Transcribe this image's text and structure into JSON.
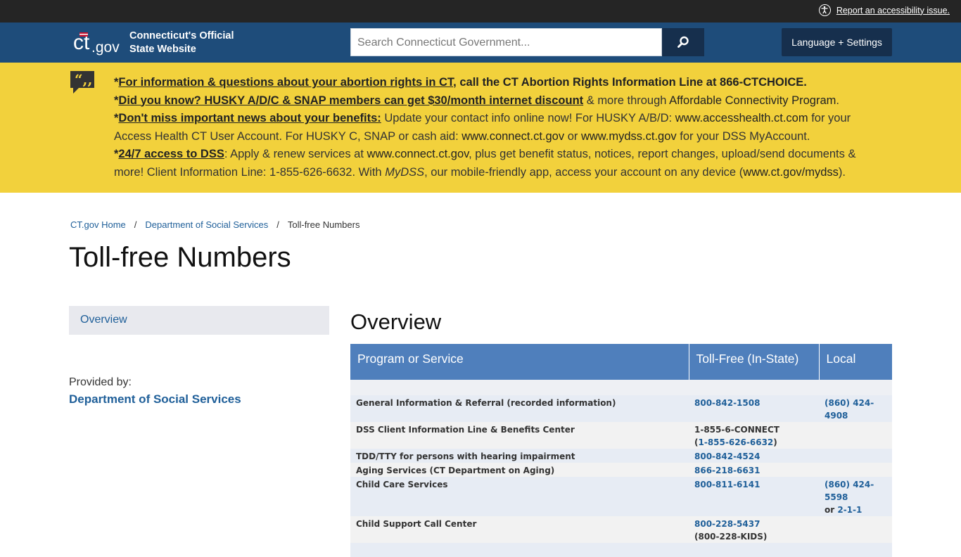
{
  "utility": {
    "accessibility_link": "Report an accessibility issue."
  },
  "header": {
    "logo_alt": "ct.gov",
    "site_name_line1": "Connecticut's Official",
    "site_name_line2": "State Website",
    "search_placeholder": "Search Connecticut Government...",
    "language_button": "Language + Settings"
  },
  "alert": {
    "line1_link": "For information & questions about your abortion rights in CT",
    "line1_rest": ", call the CT Abortion Rights Information Line at 866-CTCHOICE.",
    "line2_link": "Did you know? HUSKY A/D/C & SNAP members can get $30/month internet discount",
    "line2_mid": " & more through ",
    "line2_link2": "Affordable Connectivity Program",
    "line2_end": ".",
    "line3_link": "Don't miss important news about your benefits:",
    "line3_text1": " Update your contact info online now! For HUSKY A/B/D: ",
    "line3_link2": "www.accesshealth.ct.com",
    "line3_text2": " for your Access Health CT User Account. For HUSKY C, SNAP or cash aid: ",
    "line3_link3": "www.connect.ct.gov",
    "line3_text3": " or ",
    "line3_link4": "www.mydss.ct.gov",
    "line3_text4": " for your DSS MyAccount.",
    "line4_link": "24/7 access to DSS",
    "line4_text1": ": Apply & renew services at ",
    "line4_link2": "www.connect.ct.gov",
    "line4_text2": ", plus get benefit status, notices, report changes, upload/send documents & more! Client Information Line: 1-855-626-6632. With ",
    "line4_italic": "MyDSS",
    "line4_text3": ", our mobile-friendly app, access your account on any device (",
    "line4_link3": "www.ct.gov/mydss",
    "line4_text4": ")."
  },
  "breadcrumb": {
    "home": "CT.gov Home",
    "sep": "/",
    "dept": "Department of Social Services",
    "current": "Toll-free Numbers"
  },
  "page_title": "Toll-free Numbers",
  "sidebar": {
    "nav_item": "Overview",
    "provided_by_label": "Provided by:",
    "provided_by_agency": "Department of Social Services"
  },
  "main": {
    "section_heading": "Overview",
    "table": {
      "headers": [
        "Program or Service",
        "Toll-Free (In-State)",
        "Local"
      ],
      "rows": [
        {
          "program": "General Information & Referral (recorded information)",
          "tollfree_link": "800-842-1508",
          "tollfree_extra": "",
          "local_link": "(860) 424-4908",
          "local_extra": ""
        },
        {
          "program": "DSS Client Information Line & Benefits Center",
          "tollfree_plain": "1-855-6-CONNECT",
          "tollfree_paren_open": "(",
          "tollfree_link": "1-855-626-6632",
          "tollfree_paren_close": ")",
          "local_link": "",
          "local_extra": ""
        },
        {
          "program": "TDD/TTY for persons with hearing impairment",
          "tollfree_link": "800-842-4524",
          "local_link": ""
        },
        {
          "program": "Aging Services (CT Department on Aging)",
          "tollfree_link": "866-218-6631",
          "local_link": ""
        },
        {
          "program": "Child Care Services",
          "tollfree_link": "800-811-6141",
          "local_link": "(860) 424-5598",
          "local_or": " or ",
          "local_link2": "2-1-1"
        },
        {
          "program": "Child Support Call Center",
          "tollfree_link": "800-228-5437",
          "tollfree_extra": "(800-228-KIDS)",
          "local_link": ""
        }
      ]
    }
  },
  "colors": {
    "utility_bar": "#252525",
    "header": "#1e4c7a",
    "search_button": "#162f4d",
    "alert": "#f2d13c",
    "table_header": "#4f7fbc",
    "link": "#1f5f99"
  }
}
